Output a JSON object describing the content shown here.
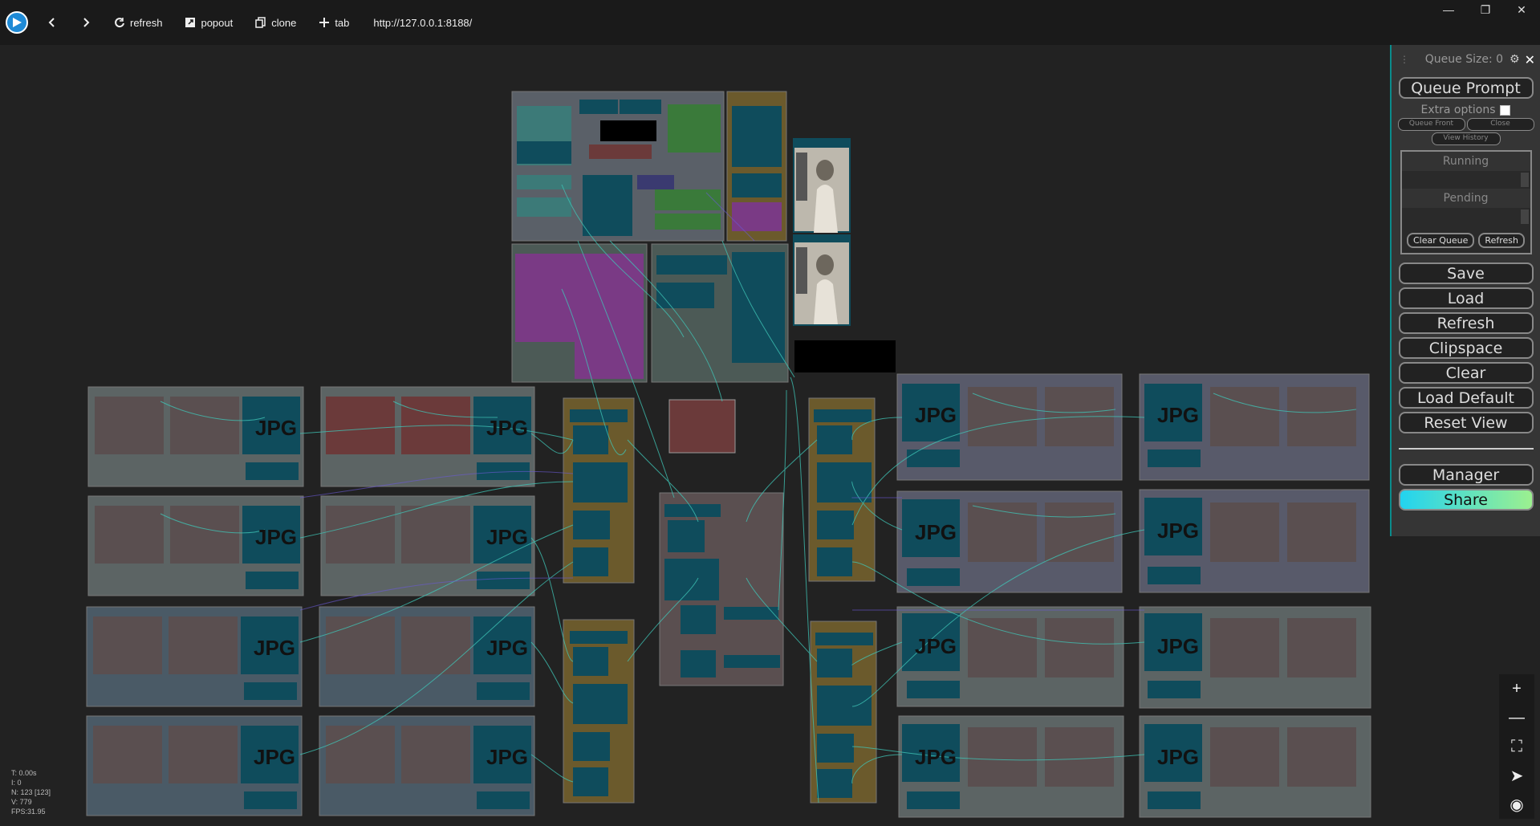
{
  "browser": {
    "refresh_label": "refresh",
    "popout_label": "popout",
    "clone_label": "clone",
    "tab_label": "tab",
    "url": "http://127.0.0.1:8188/"
  },
  "menu": {
    "queue_size": "Queue Size: 0",
    "queue_prompt": "Queue Prompt",
    "extra_options": "Extra options",
    "queue_front": "Queue Front",
    "close": "Close",
    "view_history": "View History",
    "running": "Running",
    "pending": "Pending",
    "clear_queue": "Clear Queue",
    "refresh_small": "Refresh",
    "save": "Save",
    "load": "Load",
    "refresh": "Refresh",
    "clipspace": "Clipspace",
    "clear": "Clear",
    "load_default": "Load Default",
    "reset_view": "Reset View",
    "manager": "Manager",
    "share": "Share"
  },
  "stats": {
    "t": "T: 0.00s",
    "i": "I: 0",
    "n": "N: 123 [123]",
    "v": "V: 779",
    "fps": "FPS:31.95"
  },
  "jpg_label": "JPG",
  "colors": {
    "accent": "#0a8c8c",
    "node_teal": "#0f4c5c",
    "group_orange": "#6b5a2c",
    "group_grey": "#5a6068",
    "group_purple": "#7a3a85"
  }
}
